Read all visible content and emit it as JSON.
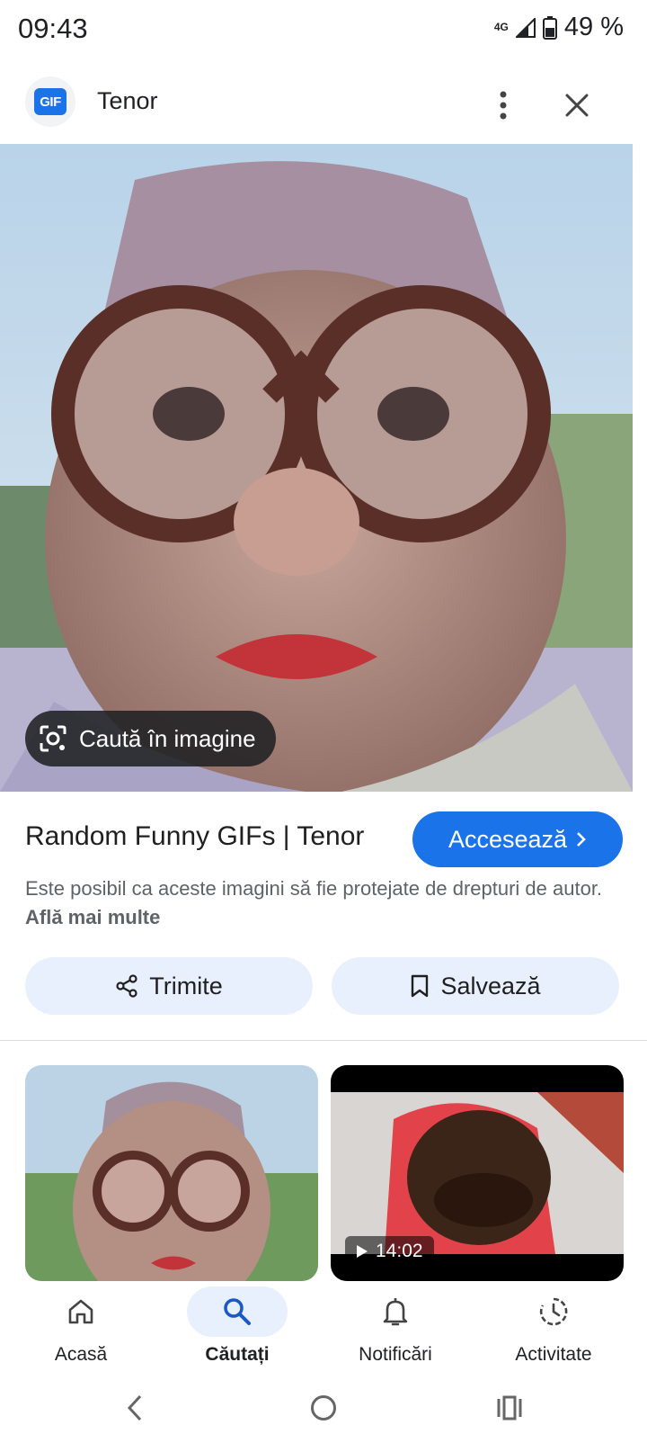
{
  "status_bar": {
    "time": "09:43",
    "network": "4G",
    "battery": "49 %"
  },
  "header": {
    "app_name": "Tenor",
    "logo_text": "GIF"
  },
  "hero": {
    "lens_label": "Caută în imagine"
  },
  "result": {
    "title": "Random Funny GIFs | Tenor",
    "visit_label": "Accesează",
    "copyright_text": "Este posibil ca aceste imagini să fie protejate de drepturi de autor.",
    "learn_more": "Află mai multe"
  },
  "actions": {
    "share_label": "Trimite",
    "save_label": "Salvează"
  },
  "thumbnails": [
    {
      "duration": ""
    },
    {
      "duration": "14:02"
    }
  ],
  "bottom_nav": {
    "items": [
      {
        "label": "Acasă",
        "icon": "home-icon",
        "active": false
      },
      {
        "label": "Căutați",
        "icon": "search-icon",
        "active": true
      },
      {
        "label": "Notificări",
        "icon": "bell-icon",
        "active": false
      },
      {
        "label": "Activitate",
        "icon": "history-icon",
        "active": false
      }
    ]
  },
  "colors": {
    "accent": "#1a73e8",
    "chip_bg": "#e8f0fe",
    "muted_text": "#5f6368"
  }
}
